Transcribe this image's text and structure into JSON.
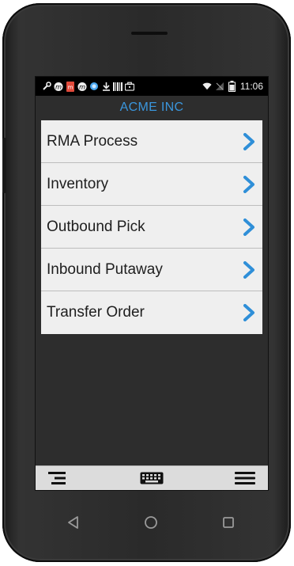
{
  "status_bar": {
    "time": "11:06",
    "icons_left": [
      "wrench-icon",
      "m-app-icon",
      "m-red-icon",
      "m-app-icon-2",
      "globe-icon",
      "download-icon",
      "barcode-icon",
      "briefcase-icon"
    ],
    "icons_right": [
      "wifi-icon",
      "no-signal-icon",
      "battery-icon"
    ]
  },
  "app": {
    "title": "ACME INC"
  },
  "menu": {
    "items": [
      {
        "label": "RMA Process"
      },
      {
        "label": "Inventory"
      },
      {
        "label": "Outbound Pick"
      },
      {
        "label": "Inbound Putaway"
      },
      {
        "label": "Transfer Order"
      }
    ]
  },
  "toolbar": {
    "left_icon": "indent-menu-icon",
    "center_icon": "keyboard-icon",
    "right_icon": "hamburger-menu-icon"
  },
  "nav": {
    "back_icon": "back-triangle-icon",
    "home_icon": "home-circle-icon",
    "recents_icon": "recents-square-icon"
  },
  "colors": {
    "accent": "#3a96dd",
    "chevron": "#2f8fd8",
    "screen_bg": "#2d2d2d",
    "menu_bg": "#efefef"
  }
}
